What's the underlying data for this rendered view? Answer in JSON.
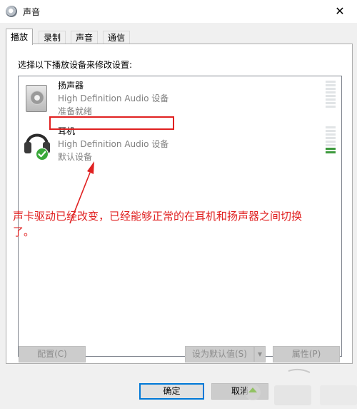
{
  "window": {
    "title": "声音",
    "close_glyph": "✕"
  },
  "tabs": [
    {
      "label": "播放",
      "active": true
    },
    {
      "label": "录制",
      "active": false
    },
    {
      "label": "声音",
      "active": false
    },
    {
      "label": "通信",
      "active": false
    }
  ],
  "panel": {
    "prompt": "选择以下播放设备来修改设置:"
  },
  "devices": [
    {
      "name": "扬声器",
      "description": "High Definition Audio 设备",
      "status": "准备就绪",
      "icon": "speaker-icon",
      "level": 0
    },
    {
      "name": "耳机",
      "description": "High Definition Audio 设备",
      "status": "默认设备",
      "icon": "headphones-icon",
      "default": true,
      "level": 0.2
    }
  ],
  "annotation": {
    "text": "声卡驱动已经改变，已经能够正常的在耳机和扬声器之间切换了。",
    "color": "#e02020"
  },
  "buttons": {
    "configure": "配置(C)",
    "set_default": "设为默认值(S)",
    "set_default_arrow": "▾",
    "properties": "属性(P)",
    "ok": "确定",
    "cancel": "取消"
  },
  "colors": {
    "accent": "#0078d7",
    "annotation_red": "#e02020",
    "meter_on": "#3d9a3d"
  }
}
